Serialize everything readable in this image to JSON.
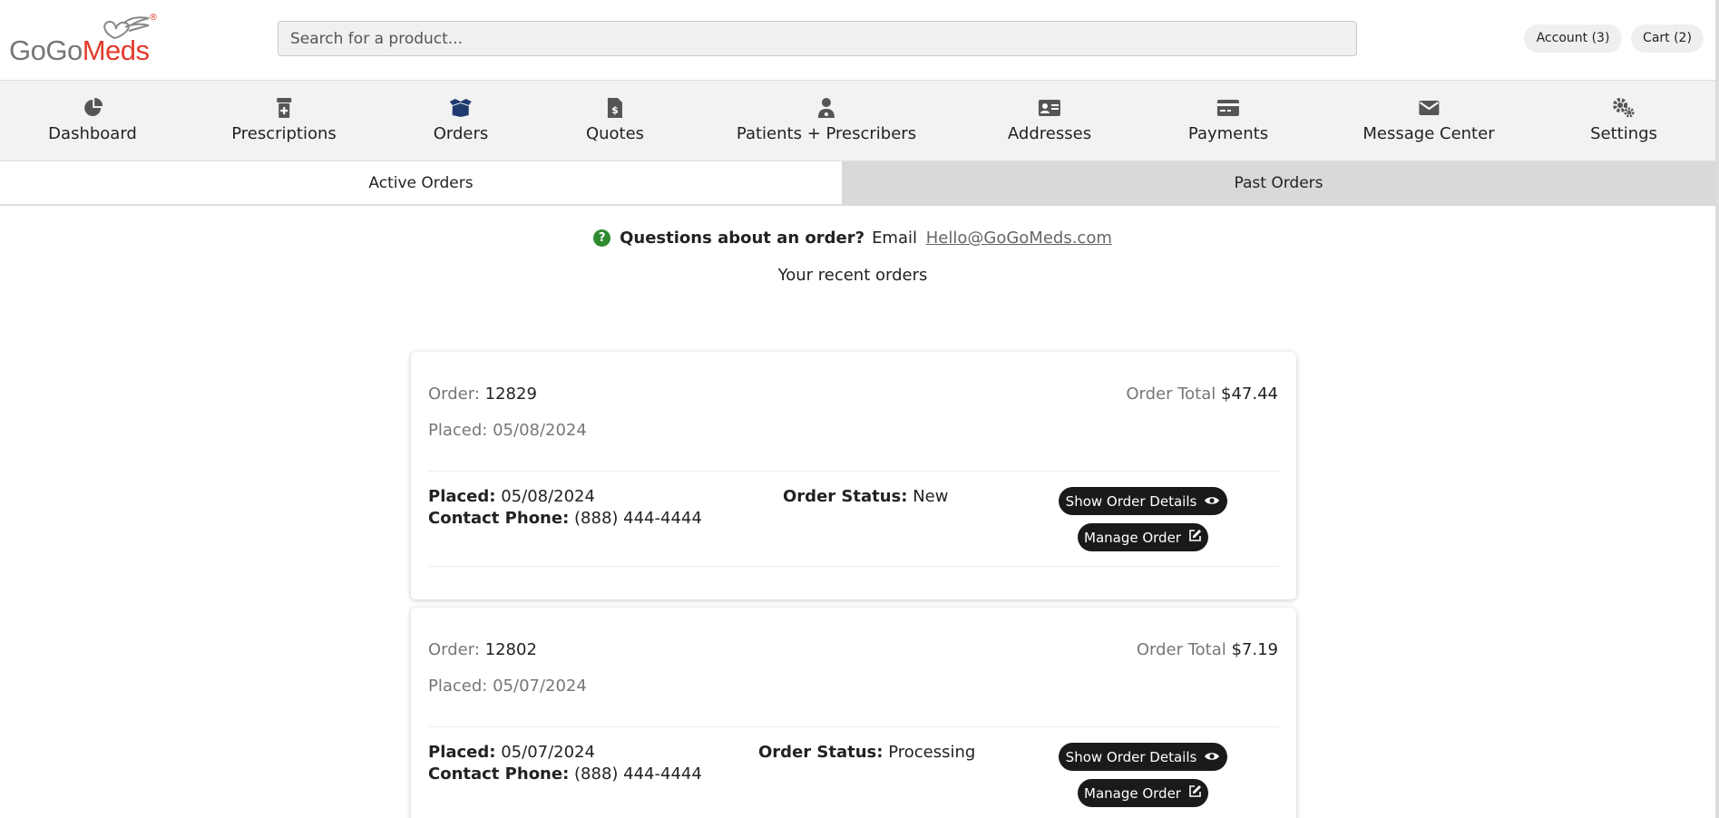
{
  "brand": {
    "gogo": "GoGo",
    "meds": "Meds",
    "reg": "®"
  },
  "search": {
    "placeholder": "Search for a product..."
  },
  "header": {
    "account_label": "Account (3)",
    "cart_label": "Cart (2)"
  },
  "nav": [
    {
      "label": "Dashboard",
      "icon": "pie-chart-icon"
    },
    {
      "label": "Prescriptions",
      "icon": "prescription-bottle-icon"
    },
    {
      "label": "Orders",
      "icon": "box-open-icon"
    },
    {
      "label": "Quotes",
      "icon": "file-invoice-dollar-icon"
    },
    {
      "label": "Patients + Prescribers",
      "icon": "user-doctor-icon"
    },
    {
      "label": "Addresses",
      "icon": "address-card-icon"
    },
    {
      "label": "Payments",
      "icon": "credit-card-icon"
    },
    {
      "label": "Message Center",
      "icon": "envelope-icon"
    },
    {
      "label": "Settings",
      "icon": "gears-icon"
    }
  ],
  "tabs": {
    "active": "Active Orders",
    "past": "Past Orders"
  },
  "info": {
    "question": "Questions about an order?",
    "email_label": "Email",
    "email": "Hello@GoGoMeds.com",
    "recent": "Your recent orders"
  },
  "labels": {
    "order": "Order:",
    "placed_top": "Placed:",
    "order_total": "Order Total",
    "placed": "Placed:",
    "contact_phone": "Contact Phone:",
    "order_status": "Order Status:",
    "show_details": "Show Order Details",
    "manage_order": "Manage Order"
  },
  "orders": [
    {
      "number": "12829",
      "placed": "05/08/2024",
      "total": "$47.44",
      "phone": "(888) 444-4444",
      "status": "New"
    },
    {
      "number": "12802",
      "placed": "05/07/2024",
      "total": "$7.19",
      "phone": "(888) 444-4444",
      "status": "Processing"
    }
  ],
  "colors": {
    "brand_red": "#e23b2d",
    "accent_navy": "#1f3a6e",
    "help_green": "#2f8a2f",
    "button_dark": "#1a1a1a"
  }
}
